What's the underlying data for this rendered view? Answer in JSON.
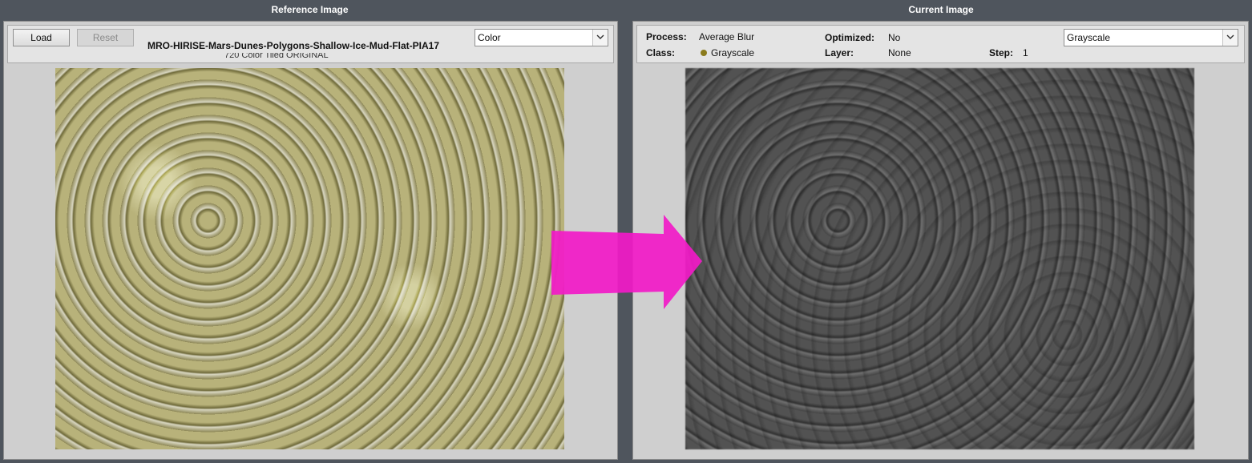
{
  "reference": {
    "title": "Reference Image",
    "load_label": "Load",
    "reset_label": "Reset",
    "file_name": "MRO-HIRISE-Mars-Dunes-Polygons-Shallow-Ice-Mud-Flat-PIA17",
    "file_subline": "720 Color Tiled ORIGINAL",
    "color_mode": "Color"
  },
  "current": {
    "title": "Current Image",
    "process_label": "Process:",
    "process_value": "Average Blur",
    "optimized_label": "Optimized:",
    "optimized_value": "No",
    "class_label": "Class:",
    "class_value": "Grayscale",
    "layer_label": "Layer:",
    "layer_value": "None",
    "step_label": "Step:",
    "step_value": "1",
    "color_mode": "Grayscale"
  },
  "colors": {
    "background": "#4f555d",
    "panel": "#cfcfcf",
    "arrow": "#f21ac8",
    "class_dot": "#8a7a1c"
  },
  "icons": {
    "dropdown": "chevron-down-icon",
    "transition": "arrow-right-icon"
  }
}
